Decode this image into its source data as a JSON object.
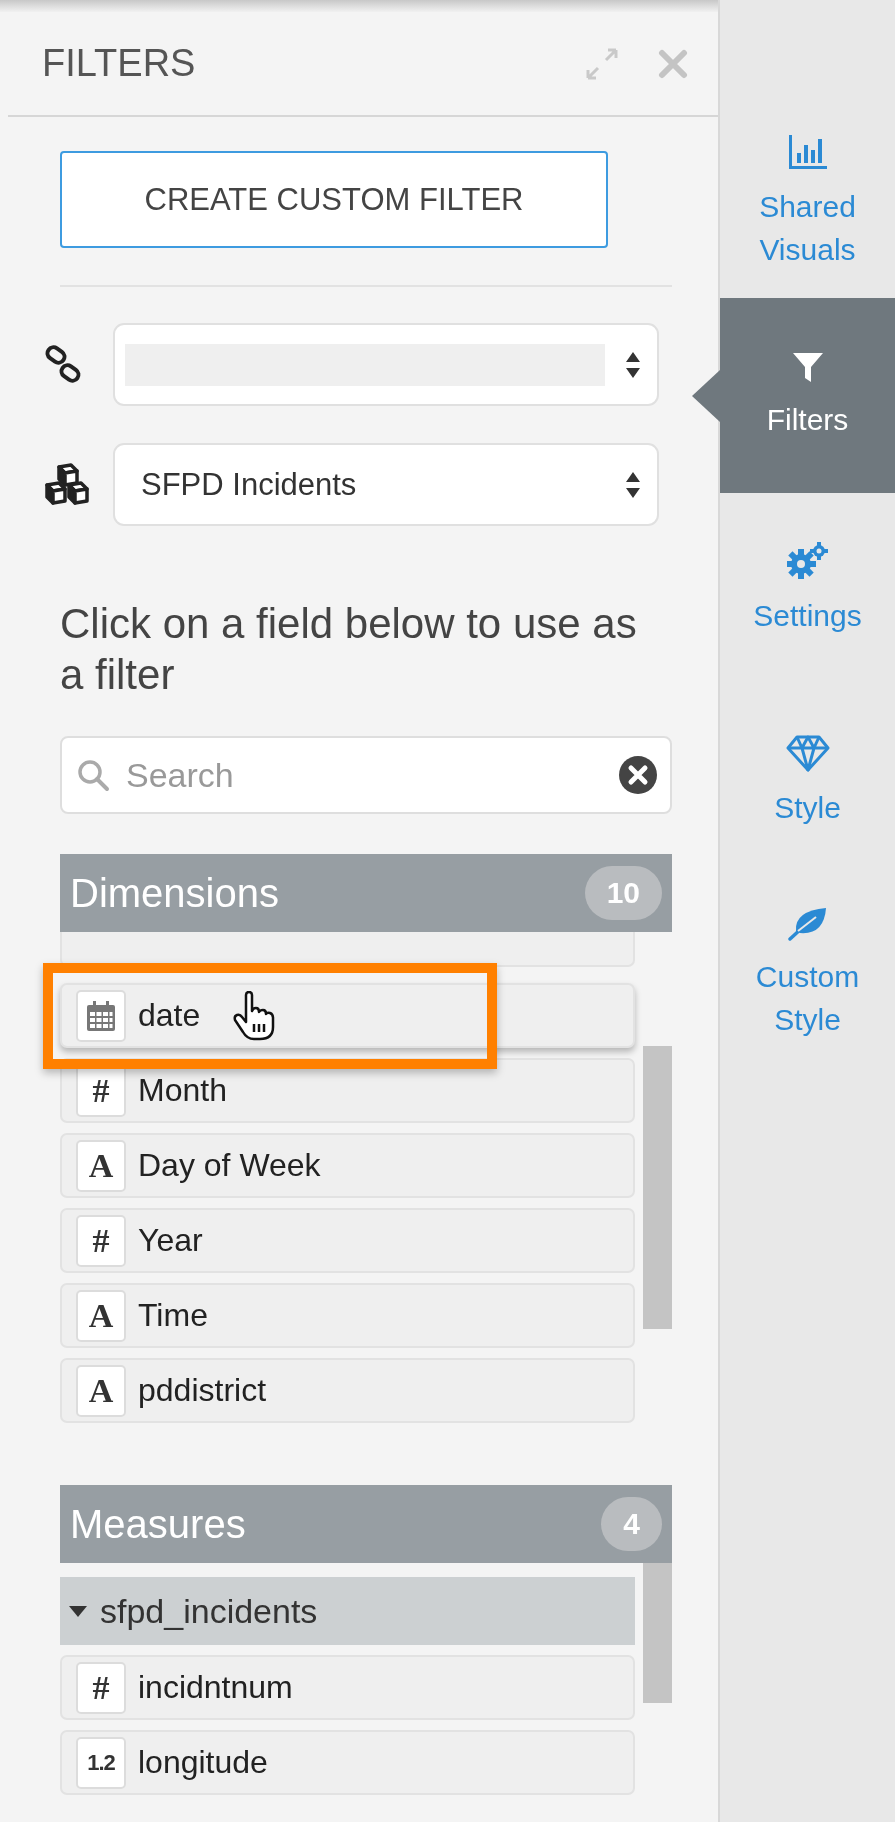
{
  "panel": {
    "title": "FILTERS",
    "create_button": "CREATE CUSTOM FILTER",
    "selects": [
      {
        "kind": "link"
      },
      {
        "kind": "dataset",
        "value": "SFPD Incidents"
      }
    ],
    "instruction": "Click on a field below to use as a filter",
    "search": {
      "placeholder": "Search"
    },
    "sections": [
      {
        "title": "Dimensions",
        "count": "10",
        "items": [
          {
            "kind": "cut_off"
          },
          {
            "kind": "date",
            "label": "date",
            "highlighted": true
          },
          {
            "kind": "number",
            "glyph": "#",
            "label": "Month",
            "highlighted": false
          },
          {
            "kind": "text",
            "glyph": "A",
            "label": "Day of Week",
            "highlighted": false
          },
          {
            "kind": "number",
            "glyph": "#",
            "label": "Year",
            "highlighted": false
          },
          {
            "kind": "text",
            "glyph": "A",
            "label": "Time",
            "highlighted": false
          },
          {
            "kind": "text",
            "glyph": "A",
            "label": "pddistrict",
            "highlighted": false
          }
        ]
      },
      {
        "title": "Measures",
        "count": "4",
        "items": [
          {
            "kind": "group",
            "label": "sfpd_incidents",
            "expanded": true
          },
          {
            "kind": "number",
            "glyph": "#",
            "label": "incidntnum",
            "highlighted": false
          },
          {
            "kind": "decimal",
            "glyph": "1.2",
            "label": "longitude",
            "highlighted": false
          }
        ]
      }
    ]
  },
  "sidebar": {
    "items": [
      {
        "kind": "chart",
        "label": "Shared Visuals",
        "selected": false
      },
      {
        "kind": "filter",
        "label": "Filters",
        "selected": true
      },
      {
        "kind": "gears",
        "label": "Settings",
        "selected": false
      },
      {
        "kind": "gem",
        "label": "Style",
        "selected": false
      },
      {
        "kind": "leaf",
        "label": "Custom Style",
        "selected": false
      }
    ]
  }
}
